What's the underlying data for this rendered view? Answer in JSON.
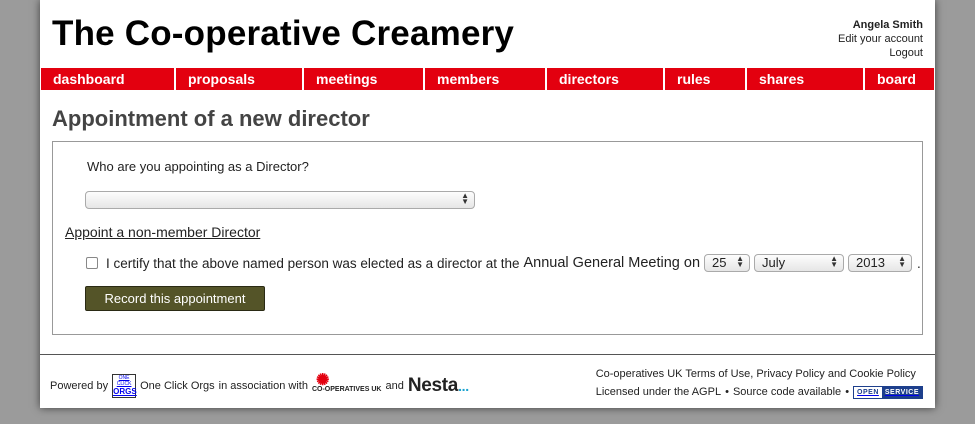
{
  "header": {
    "title": "The Co-operative Creamery",
    "user_name": "Angela Smith",
    "edit_account": "Edit your account",
    "logout": "Logout"
  },
  "nav": {
    "items": [
      {
        "label": "dashboard"
      },
      {
        "label": "proposals"
      },
      {
        "label": "meetings"
      },
      {
        "label": "members"
      },
      {
        "label": "directors"
      },
      {
        "label": "rules"
      },
      {
        "label": "shares"
      },
      {
        "label": "board"
      }
    ]
  },
  "main": {
    "heading": "Appointment of a new director",
    "question": "Who are you appointing as a Director?",
    "director_select_value": "",
    "nonmember_link": "Appoint a non-member Director",
    "certify_text": "I certify that the above named person was elected as a director at the",
    "meeting_text": "Annual General Meeting on",
    "day_value": "25",
    "month_value": "July",
    "year_value": "2013",
    "period": ".",
    "record_button": "Record this appointment"
  },
  "footer": {
    "powered_by": "Powered by",
    "oco_logo_top": "ONE CLICK",
    "oco_logo_mark": "ORGS",
    "oco_name": "One Click Orgs",
    "assoc": "in association with",
    "coop_logo": "CO-OPERATIVES UK",
    "and": "and",
    "nesta": "Nesta",
    "nesta_dots": "...",
    "coops_uk": "Co-operatives UK",
    "terms": "Terms of Use",
    "comma": ",",
    "privacy": "Privacy Policy",
    "and2": "and",
    "cookie": "Cookie Policy",
    "licensed": "Licensed under the AGPL",
    "bullet1": "•",
    "source": "Source code available",
    "bullet2": "•",
    "badge_open": "OPEN",
    "badge_service": "SERVICE"
  },
  "colors": {
    "nav_red": "#e3000f",
    "button_olive": "#545428",
    "badge_blue": "#1d3f8c"
  }
}
